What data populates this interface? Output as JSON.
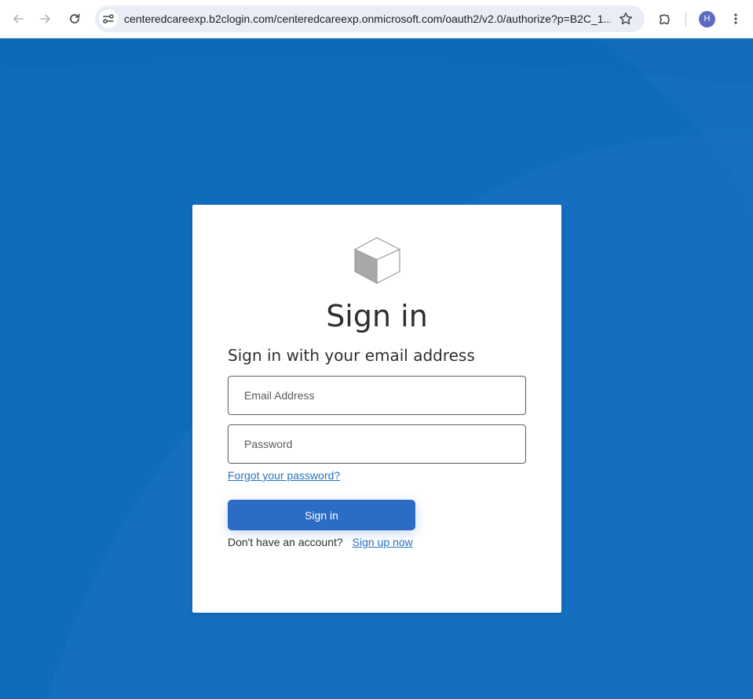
{
  "browser": {
    "url": "centeredcareexp.b2clogin.com/centeredcareexp.onmicrosoft.com/oauth2/v2.0/authorize?p=B2C_1...",
    "profile_initial": "H",
    "icons": [
      "back-arrow-icon",
      "forward-arrow-icon",
      "reload-icon",
      "site-info-icon",
      "star-icon",
      "extensions-icon",
      "kebab-menu-icon"
    ]
  },
  "signin": {
    "logo_icon": "cube-logo-icon",
    "title": "Sign in",
    "subtitle": "Sign in with your email address",
    "email_placeholder": "Email Address",
    "password_placeholder": "Password",
    "forgot_link": "Forgot your password?",
    "submit_label": "Sign in",
    "no_account_text": "Don't have an account?",
    "signup_link": "Sign up now"
  },
  "colors": {
    "page_background": "#0f6cbd",
    "primary_button": "#2b6cc4",
    "link": "#2673c0",
    "avatar": "#5c6bc0"
  }
}
